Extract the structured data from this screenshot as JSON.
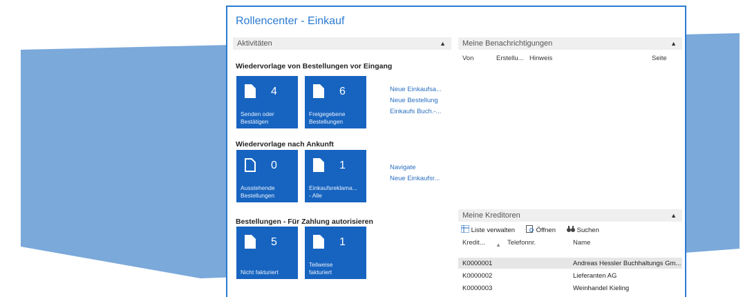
{
  "colors": {
    "accent": "#2a7ad0",
    "tile": "#1764c0",
    "banner": "#7aa9da"
  },
  "window": {
    "title": "Rollencenter - Einkauf"
  },
  "activities": {
    "header": "Aktivitäten",
    "sections": [
      {
        "title": "Wiedervorlage von Bestellungen vor Eingang",
        "tiles": [
          {
            "count": "4",
            "caption": "Senden oder Bestätigen",
            "icon": "document-icon"
          },
          {
            "count": "6",
            "caption": "Freigegebene Bestellungen",
            "icon": "document-icon"
          }
        ],
        "links": [
          "Neue Einkaufsa...",
          "Neue Bestellung",
          "Einkaufs Buch.-..."
        ]
      },
      {
        "title": "Wiedervorlage nach Ankunft",
        "tiles": [
          {
            "count": "0",
            "caption": "Ausstehende Bestellungen",
            "icon": "document-outline-icon"
          },
          {
            "count": "1",
            "caption": "Einkaufsreklama... - Alle",
            "icon": "document-icon"
          }
        ],
        "links": [
          "Navigate",
          "Neue Einkaufsr..."
        ]
      },
      {
        "title": "Bestellungen - Für Zahlung autorisieren",
        "tiles": [
          {
            "count": "5",
            "caption": "Nicht fakturiert",
            "icon": "document-icon"
          },
          {
            "count": "1",
            "caption": "Teilweise fakturiert",
            "icon": "document-icon"
          }
        ],
        "links": []
      }
    ]
  },
  "notifications": {
    "header": "Meine Benachrichtigungen",
    "columns": [
      "Von",
      "Erstellu...",
      "Hinweis",
      "Seite"
    ]
  },
  "vendors": {
    "header": "Meine Kreditoren",
    "toolbar": {
      "manage": "Liste verwalten",
      "open": "Öffnen",
      "search": "Suchen"
    },
    "columns": [
      "Kredit...",
      "Telefonnr.",
      "Name"
    ],
    "rows": [
      {
        "id": "K0000001",
        "phone": "",
        "name": "Andreas Hessler Buchhaltungs Gm..."
      },
      {
        "id": "K0000002",
        "phone": "",
        "name": "Lieferanten AG"
      },
      {
        "id": "K0000003",
        "phone": "",
        "name": "Weinhandel Kieling"
      }
    ]
  }
}
